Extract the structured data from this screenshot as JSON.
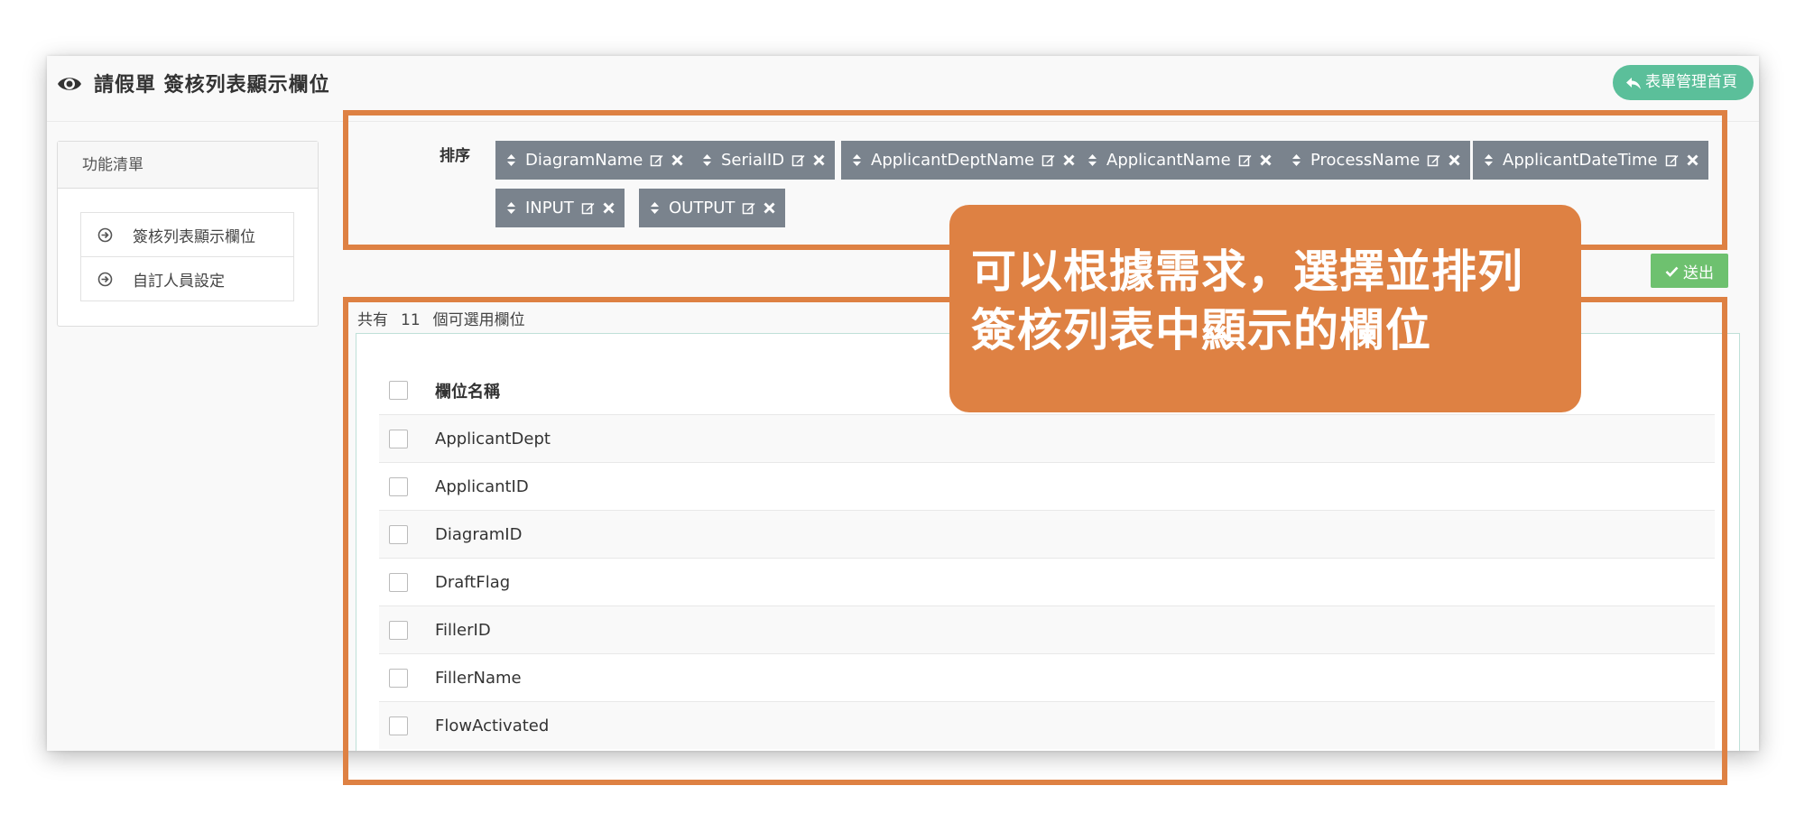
{
  "header": {
    "title_icon": "eye-icon",
    "title": "請假單  簽核列表顯示欄位",
    "home_button": "表單管理首頁",
    "home_icon": "reply-icon"
  },
  "sidebar": {
    "title": "功能清單",
    "items": [
      {
        "label": "簽核列表顯示欄位",
        "icon": "circle-arrow-right-icon"
      },
      {
        "label": "自訂人員設定",
        "icon": "circle-arrow-right-icon"
      }
    ]
  },
  "sort": {
    "label": "排序",
    "chips": [
      "DiagramName",
      "SerialID",
      "ApplicantDeptName",
      "ApplicantName",
      "ProcessName",
      "ApplicantDateTime",
      "INPUT",
      "OUTPUT"
    ]
  },
  "submit": {
    "label": "送出",
    "icon": "check-icon"
  },
  "fields": {
    "count_prefix": "共有",
    "count": "11",
    "count_suffix": "個可選用欄位",
    "header": "欄位名稱",
    "rows": [
      "ApplicantDept",
      "ApplicantID",
      "DiagramID",
      "DraftFlag",
      "FillerID",
      "FillerName",
      "FlowActivated"
    ]
  },
  "callout": {
    "line1": "可以根據需求，選擇並排列",
    "line2": "簽核列表中顯示的欄位"
  },
  "colors": {
    "accent_orange": "#de8143",
    "chip_gray": "#7a838d",
    "home_green": "#5bbf9a",
    "submit_green": "#6ec16f"
  }
}
